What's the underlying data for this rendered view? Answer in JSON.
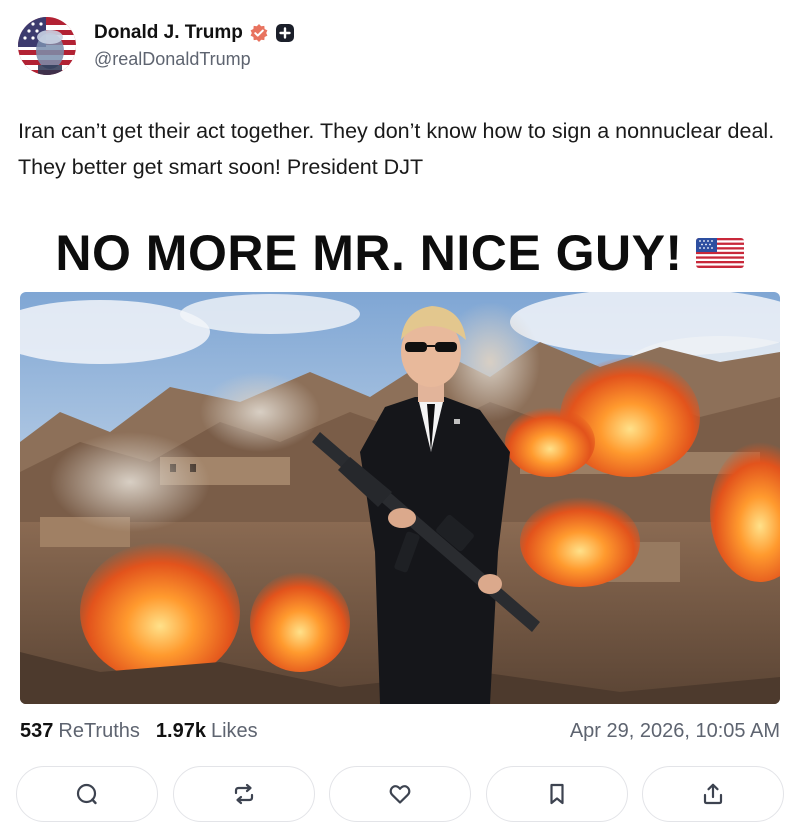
{
  "author": {
    "display_name": "Donald J. Trump",
    "handle": "@realDonaldTrump",
    "avatar_icon": "avatar-flag-portrait",
    "verified_icon": "verified-badge-icon",
    "extra_badge_icon": "plus-badge-icon",
    "verified_color": "#e8735f"
  },
  "post": {
    "text": "Iran can’t get their act together. They don’t know how to sign a nonnuclear deal. They better get smart soon! President DJT"
  },
  "image": {
    "headline": "NO MORE MR. NICE GUY!",
    "headline_emoji": "us-flag-icon"
  },
  "stats": {
    "retruths_count": "537",
    "retruths_label": "ReTruths",
    "likes_count": "1.97k",
    "likes_label": "Likes",
    "timestamp": "Apr 29, 2026, 10:05 AM"
  },
  "actions": [
    {
      "icon": "reply-icon"
    },
    {
      "icon": "retruth-icon"
    },
    {
      "icon": "like-icon"
    },
    {
      "icon": "bookmark-icon"
    },
    {
      "icon": "share-icon"
    }
  ],
  "colors": {
    "text_primary": "#111111",
    "text_secondary": "#5e6470",
    "border": "#e3e4e8"
  }
}
